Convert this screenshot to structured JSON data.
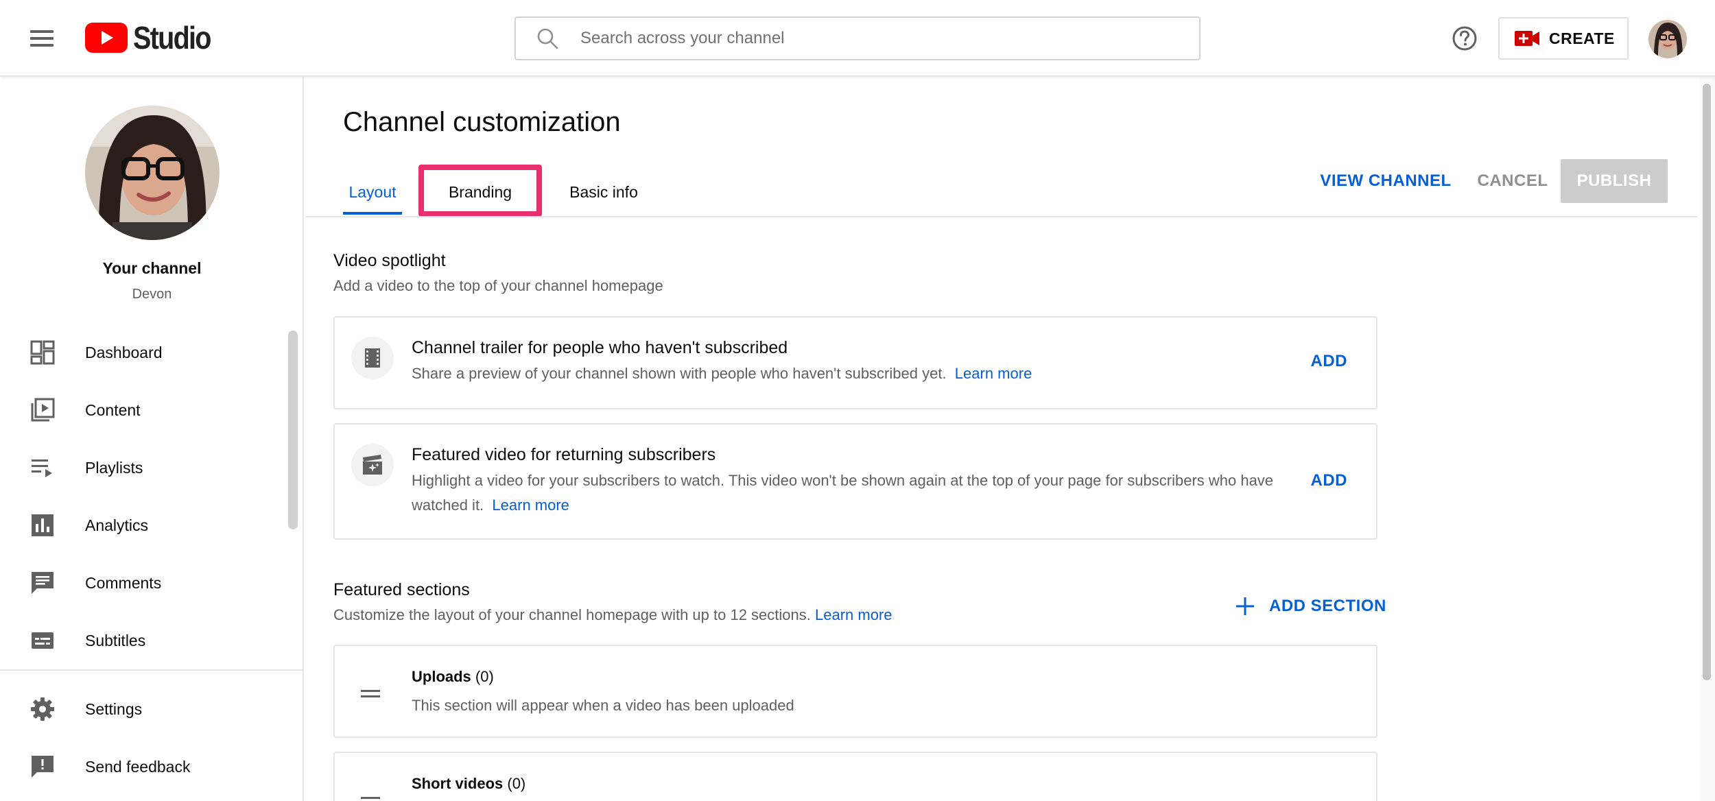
{
  "header": {
    "logo_text": "Studio",
    "search_placeholder": "Search across your channel",
    "create_label": "CREATE"
  },
  "sidebar": {
    "channel_name": "Your channel",
    "channel_handle": "Devon",
    "items": [
      {
        "label": "Dashboard",
        "icon": "dashboard-icon"
      },
      {
        "label": "Content",
        "icon": "content-icon"
      },
      {
        "label": "Playlists",
        "icon": "playlists-icon"
      },
      {
        "label": "Analytics",
        "icon": "analytics-icon"
      },
      {
        "label": "Comments",
        "icon": "comments-icon"
      },
      {
        "label": "Subtitles",
        "icon": "subtitles-icon"
      },
      {
        "label": "Settings",
        "icon": "settings-icon"
      },
      {
        "label": "Send feedback",
        "icon": "feedback-icon"
      }
    ]
  },
  "main": {
    "title": "Channel customization",
    "tabs": [
      {
        "label": "Layout",
        "active": true
      },
      {
        "label": "Branding",
        "highlighted": true
      },
      {
        "label": "Basic info"
      }
    ],
    "actions": {
      "view_channel": "VIEW CHANNEL",
      "cancel": "CANCEL",
      "publish": "PUBLISH"
    },
    "video_spotlight": {
      "title": "Video spotlight",
      "description": "Add a video to the top of your channel homepage",
      "cards": [
        {
          "title": "Channel trailer for people who haven't subscribed",
          "description": "Share a preview of your channel shown with people who haven't subscribed yet.",
          "link": "Learn more",
          "action": "ADD"
        },
        {
          "title": "Featured video for returning subscribers",
          "description_line1": "Highlight a video for your subscribers to watch. This video won't be shown again at the top of your page for subscribers who have",
          "description_line2": "watched it.",
          "link": "Learn more",
          "action": "ADD"
        }
      ]
    },
    "featured_sections": {
      "title": "Featured sections",
      "description": "Customize the layout of your channel homepage with up to 12 sections.",
      "link": "Learn more",
      "add_section": "ADD SECTION",
      "sections": [
        {
          "name": "Uploads",
          "count": "(0)",
          "description": "This section will appear when a video has been uploaded"
        },
        {
          "name": "Short videos",
          "count": "(0)"
        }
      ]
    }
  },
  "colors": {
    "accent": "#065fd4",
    "highlight": "#e8306e",
    "youtube_red": "#ff0000"
  }
}
